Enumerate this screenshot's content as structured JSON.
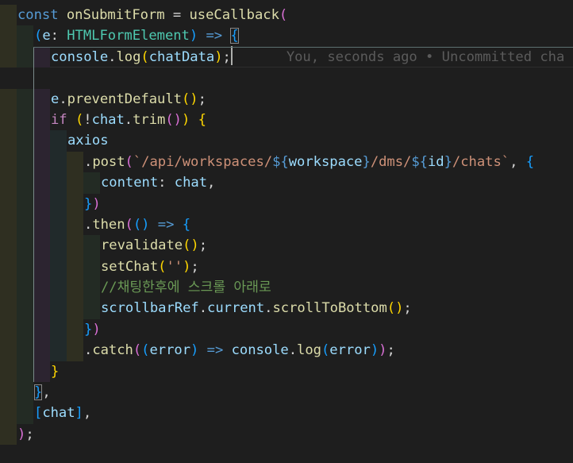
{
  "colors": {
    "kw": "#569cd6",
    "var": "#9cdcfe",
    "fn": "#dcdcaa",
    "type": "#4ec9b0",
    "str": "#ce9178",
    "cmt": "#6a9955",
    "ctl": "#c586c0",
    "pun": "#d4d4d4",
    "b1": "#ffd700",
    "b2": "#da70d6",
    "b3": "#179fff",
    "guides": [
      "#2f2f21",
      "#232b24",
      "#2c2430",
      "#212a2b"
    ]
  },
  "blame": "You, seconds ago • Uncommitted cha",
  "lines": [
    {
      "indent": 0,
      "tokens": [
        {
          "t": "const ",
          "c": "kw"
        },
        {
          "t": "onSubmitForm",
          "c": "fn"
        },
        {
          "t": " = ",
          "c": "pun"
        },
        {
          "t": "useCallback",
          "c": "fn"
        },
        {
          "t": "(",
          "c": "b2"
        }
      ]
    },
    {
      "indent": 1,
      "tokens": [
        {
          "t": "(",
          "c": "b3"
        },
        {
          "t": "e",
          "c": "var"
        },
        {
          "t": ": ",
          "c": "pun"
        },
        {
          "t": "HTMLFormElement",
          "c": "type"
        },
        {
          "t": ")",
          "c": "b3"
        },
        {
          "t": " => ",
          "c": "kw"
        },
        {
          "t": "{",
          "c": "b3",
          "match": true
        }
      ]
    },
    {
      "indent": 2,
      "current": true,
      "tokens": [
        {
          "t": "console",
          "c": "var"
        },
        {
          "t": ".",
          "c": "pun"
        },
        {
          "t": "log",
          "c": "fn"
        },
        {
          "t": "(",
          "c": "b1"
        },
        {
          "t": "chatData",
          "c": "var"
        },
        {
          "t": ")",
          "c": "b1"
        },
        {
          "t": ";",
          "c": "pun"
        }
      ]
    },
    {
      "indent": 0,
      "empty": true,
      "tokens": []
    },
    {
      "indent": 2,
      "tokens": [
        {
          "t": "e",
          "c": "var"
        },
        {
          "t": ".",
          "c": "pun"
        },
        {
          "t": "preventDefault",
          "c": "fn"
        },
        {
          "t": "()",
          "c": "b1"
        },
        {
          "t": ";",
          "c": "pun"
        }
      ]
    },
    {
      "indent": 2,
      "tokens": [
        {
          "t": "if ",
          "c": "ctl"
        },
        {
          "t": "(",
          "c": "b1"
        },
        {
          "t": "!",
          "c": "pun"
        },
        {
          "t": "chat",
          "c": "var"
        },
        {
          "t": ".",
          "c": "pun"
        },
        {
          "t": "trim",
          "c": "fn"
        },
        {
          "t": "()",
          "c": "b2"
        },
        {
          "t": ")",
          "c": "b1"
        },
        {
          "t": " ",
          "c": "pun"
        },
        {
          "t": "{",
          "c": "b1"
        }
      ]
    },
    {
      "indent": 3,
      "tokens": [
        {
          "t": "axios",
          "c": "var"
        }
      ]
    },
    {
      "indent": 4,
      "tokens": [
        {
          "t": ".",
          "c": "pun"
        },
        {
          "t": "post",
          "c": "fn"
        },
        {
          "t": "(",
          "c": "b2"
        },
        {
          "t": "`/api/workspaces/",
          "c": "str"
        },
        {
          "t": "${",
          "c": "kw"
        },
        {
          "t": "workspace",
          "c": "var"
        },
        {
          "t": "}",
          "c": "kw"
        },
        {
          "t": "/dms/",
          "c": "str"
        },
        {
          "t": "${",
          "c": "kw"
        },
        {
          "t": "id",
          "c": "var"
        },
        {
          "t": "}",
          "c": "kw"
        },
        {
          "t": "/chats`",
          "c": "str"
        },
        {
          "t": ", ",
          "c": "pun"
        },
        {
          "t": "{",
          "c": "b3"
        }
      ]
    },
    {
      "indent": 5,
      "tokens": [
        {
          "t": "content",
          "c": "var"
        },
        {
          "t": ": ",
          "c": "pun"
        },
        {
          "t": "chat",
          "c": "var"
        },
        {
          "t": ",",
          "c": "pun"
        }
      ]
    },
    {
      "indent": 4,
      "tokens": [
        {
          "t": "}",
          "c": "b3"
        },
        {
          "t": ")",
          "c": "b2"
        }
      ]
    },
    {
      "indent": 4,
      "tokens": [
        {
          "t": ".",
          "c": "pun"
        },
        {
          "t": "then",
          "c": "fn"
        },
        {
          "t": "(",
          "c": "b2"
        },
        {
          "t": "()",
          "c": "b3"
        },
        {
          "t": " => ",
          "c": "kw"
        },
        {
          "t": "{",
          "c": "b3"
        }
      ]
    },
    {
      "indent": 5,
      "tokens": [
        {
          "t": "revalidate",
          "c": "fn"
        },
        {
          "t": "()",
          "c": "b1"
        },
        {
          "t": ";",
          "c": "pun"
        }
      ]
    },
    {
      "indent": 5,
      "tokens": [
        {
          "t": "setChat",
          "c": "fn"
        },
        {
          "t": "(",
          "c": "b1"
        },
        {
          "t": "''",
          "c": "str"
        },
        {
          "t": ")",
          "c": "b1"
        },
        {
          "t": ";",
          "c": "pun"
        }
      ]
    },
    {
      "indent": 5,
      "tokens": [
        {
          "t": "//채팅한후에 스크롤 아래로",
          "c": "cmt"
        }
      ]
    },
    {
      "indent": 5,
      "tokens": [
        {
          "t": "scrollbarRef",
          "c": "var"
        },
        {
          "t": ".",
          "c": "pun"
        },
        {
          "t": "current",
          "c": "var"
        },
        {
          "t": ".",
          "c": "pun"
        },
        {
          "t": "scrollToBottom",
          "c": "fn"
        },
        {
          "t": "()",
          "c": "b1"
        },
        {
          "t": ";",
          "c": "pun"
        }
      ]
    },
    {
      "indent": 4,
      "tokens": [
        {
          "t": "}",
          "c": "b3"
        },
        {
          "t": ")",
          "c": "b2"
        }
      ]
    },
    {
      "indent": 4,
      "tokens": [
        {
          "t": ".",
          "c": "pun"
        },
        {
          "t": "catch",
          "c": "fn"
        },
        {
          "t": "(",
          "c": "b2"
        },
        {
          "t": "(",
          "c": "b3"
        },
        {
          "t": "error",
          "c": "var"
        },
        {
          "t": ")",
          "c": "b3"
        },
        {
          "t": " => ",
          "c": "kw"
        },
        {
          "t": "console",
          "c": "var"
        },
        {
          "t": ".",
          "c": "pun"
        },
        {
          "t": "log",
          "c": "fn"
        },
        {
          "t": "(",
          "c": "b3"
        },
        {
          "t": "error",
          "c": "var"
        },
        {
          "t": ")",
          "c": "b3"
        },
        {
          "t": ")",
          "c": "b2"
        },
        {
          "t": ";",
          "c": "pun"
        }
      ]
    },
    {
      "indent": 2,
      "tokens": [
        {
          "t": "}",
          "c": "b1"
        }
      ]
    },
    {
      "indent": 1,
      "tokens": [
        {
          "t": "}",
          "c": "b3",
          "match": true
        },
        {
          "t": ",",
          "c": "pun"
        }
      ]
    },
    {
      "indent": 1,
      "tokens": [
        {
          "t": "[",
          "c": "b3"
        },
        {
          "t": "chat",
          "c": "var"
        },
        {
          "t": "]",
          "c": "b3"
        },
        {
          "t": ",",
          "c": "pun"
        }
      ]
    },
    {
      "indent": 0,
      "tokens": [
        {
          "t": ")",
          "c": "b2"
        },
        {
          "t": ";",
          "c": "pun"
        }
      ]
    }
  ]
}
